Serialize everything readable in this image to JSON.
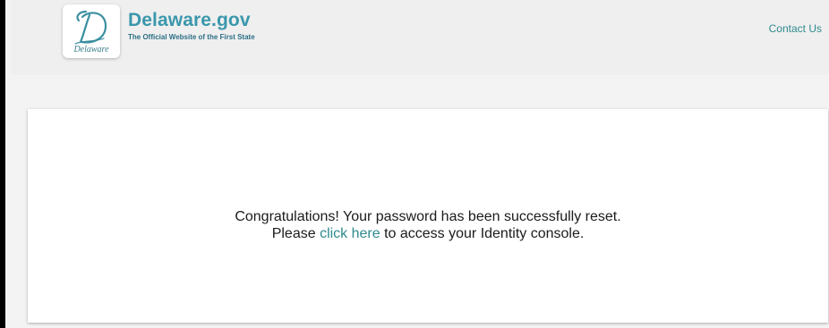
{
  "header": {
    "logo_seal_text": "Delaware",
    "brand_title": "Delaware.gov",
    "brand_subtitle": "The Official Website of the First State",
    "contact_link": "Contact Us"
  },
  "message": {
    "line1": "Congratulations! Your password has been successfully reset.",
    "line2_prefix": "Please ",
    "line2_link": "click here",
    "line2_suffix": " to access your Identity console."
  },
  "colors": {
    "brand_teal": "#3a97ac",
    "link_teal": "#2f8a8f",
    "header_bg": "#efefef",
    "page_bg": "#f3f3f3"
  }
}
